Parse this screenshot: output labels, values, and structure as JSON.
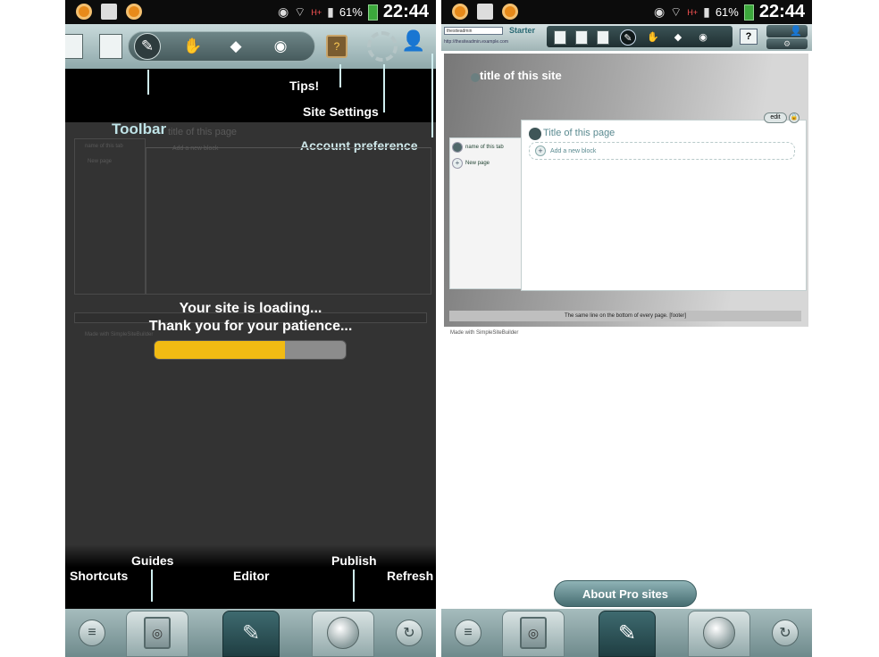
{
  "status_bar": {
    "battery": "61%",
    "time": "22:44",
    "signal_label": "H+"
  },
  "left": {
    "callouts": {
      "tips": "Tips!",
      "site_settings": "Site Settings",
      "toolbar": "Toolbar",
      "account_preference": "Account preference"
    },
    "ghost": {
      "page_title": "title of this page",
      "tab_name": "name of this tab",
      "add_block": "Add a new block",
      "new_page": "New page",
      "made_with": "Made with SimpleSiteBuilder"
    },
    "loading": {
      "line1": "Your site is loading...",
      "line2": "Thank you for your patience...",
      "progress_percent": 68
    },
    "bottom_labels": {
      "shortcuts": "Shortcuts",
      "guides": "Guides",
      "editor": "Editor",
      "publish": "Publish",
      "refresh": "Refresh"
    }
  },
  "right": {
    "toolbar": {
      "url_box": "thesiteadmin",
      "url": "http://thesiteadmin.example.com",
      "plan": "Starter",
      "help": "?"
    },
    "site": {
      "site_title": "title of this site",
      "page_title": "Title of this page",
      "add_block": "Add a new block",
      "tab_name": "name of this tab",
      "new_page": "New page",
      "page_pill": "edit",
      "footer": "The same line on the bottom of every page. [footer]",
      "made_with": "Made with SimpleSiteBuilder"
    },
    "about_pro": "About Pro sites"
  },
  "colors": {
    "progress_fill": "#f2bb13",
    "accent": "#4f7a7e"
  },
  "icons": {
    "shortcuts": "menu-icon",
    "guides": "book-icon",
    "editor": "pencil-icon",
    "publish": "globe-icon",
    "refresh": "refresh-icon"
  }
}
